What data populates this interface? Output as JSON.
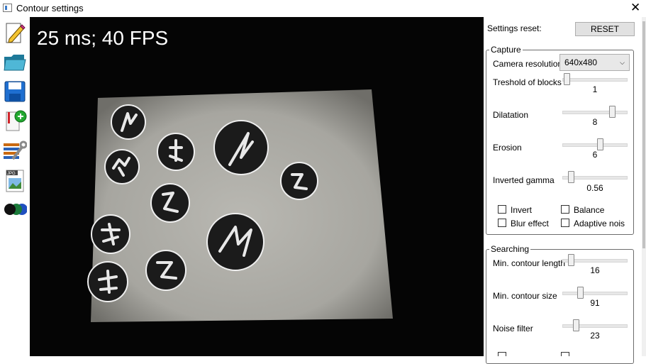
{
  "window": {
    "title": "Contour settings"
  },
  "toolbar": {
    "tools": [
      "edit-icon",
      "open-folder-icon",
      "save-icon",
      "add-document-icon",
      "settings-wrench-icon",
      "jpg-image-icon",
      "color-balls-icon"
    ]
  },
  "video": {
    "fps_text": "25 ms; 40 FPS"
  },
  "settings": {
    "reset_label": "Settings reset:",
    "reset_button": "RESET",
    "capture": {
      "title": "Capture",
      "camera_resolution_label": "Camera resolution",
      "camera_resolution_value": "640x480",
      "threshold_label": "Treshold of blocks",
      "threshold_value": "1",
      "threshold_level": 0.02,
      "dilatation_label": "Dilatation",
      "dilatation_value": "8",
      "dilatation_level": 0.82,
      "erosion_label": "Erosion",
      "erosion_value": "6",
      "erosion_level": 0.6,
      "gamma_label": "Inverted gamma",
      "gamma_value": "0.56",
      "gamma_level": 0.1,
      "invert_label": "Invert",
      "balance_label": "Balance",
      "blur_label": "Blur effect",
      "adaptive_label": "Adaptive nois"
    },
    "searching": {
      "title": "Searching",
      "min_length_label": "Min. contour length",
      "min_length_value": "16",
      "min_length_level": 0.1,
      "min_size_label": "Min. contour size",
      "min_size_value": "91",
      "min_size_level": 0.26,
      "noise_label": "Noise filter",
      "noise_value": "23",
      "noise_level": 0.18
    }
  }
}
